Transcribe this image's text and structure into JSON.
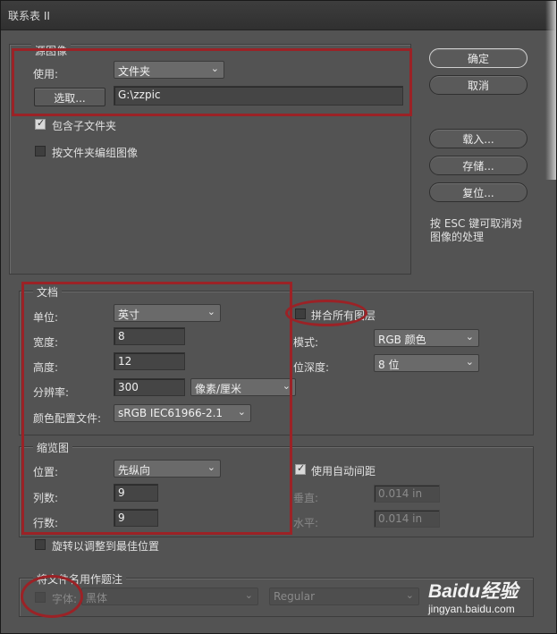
{
  "window": {
    "title": "联系表 II"
  },
  "source": {
    "legend": "源图像",
    "use_label": "使用:",
    "use_value": "文件夹",
    "choose_button": "选取...",
    "path": "G:\\zzpic",
    "include_subfolders": "包含子文件夹",
    "include_subfolders_checked": true,
    "group_by_folder": "按文件夹编组图像",
    "group_by_folder_checked": false
  },
  "buttons": {
    "ok": "确定",
    "cancel": "取消",
    "load": "载入...",
    "save": "存储...",
    "reset": "复位..."
  },
  "hint": {
    "line1": "按 ESC 键可取消对",
    "line2": "图像的处理"
  },
  "document": {
    "legend": "文档",
    "unit_label": "单位:",
    "unit_value": "英寸",
    "width_label": "宽度:",
    "width_value": "8",
    "height_label": "高度:",
    "height_value": "12",
    "resolution_label": "分辨率:",
    "resolution_value": "300",
    "resolution_unit": "像素/厘米",
    "profile_label": "颜色配置文件:",
    "profile_value": "sRGB IEC61966-2.1",
    "flatten_label": "拼合所有图层",
    "flatten_checked": false,
    "mode_label": "模式:",
    "mode_value": "RGB 颜色",
    "depth_label": "位深度:",
    "depth_value": "8 位"
  },
  "thumbnails": {
    "legend": "缩览图",
    "place_label": "位置:",
    "place_value": "先纵向",
    "columns_label": "列数:",
    "columns_value": "9",
    "rows_label": "行数:",
    "rows_value": "9",
    "auto_spacing_label": "使用自动间距",
    "auto_spacing_checked": true,
    "vertical_label": "垂直:",
    "vertical_value": "0.014 in",
    "horizontal_label": "水平:",
    "horizontal_value": "0.014 in",
    "rotate_label": "旋转以调整到最佳位置",
    "rotate_checked": false
  },
  "caption": {
    "legend": "将文件名用作题注",
    "font_label": "字体:",
    "font_value": "黑体",
    "style_value": "Regular",
    "font_checked": false
  },
  "watermark": {
    "brand": "Baidu经验",
    "url": "jingyan.baidu.com"
  },
  "colors": {
    "annotation_red": "#9b2226",
    "dialog_bg": "#535353"
  }
}
